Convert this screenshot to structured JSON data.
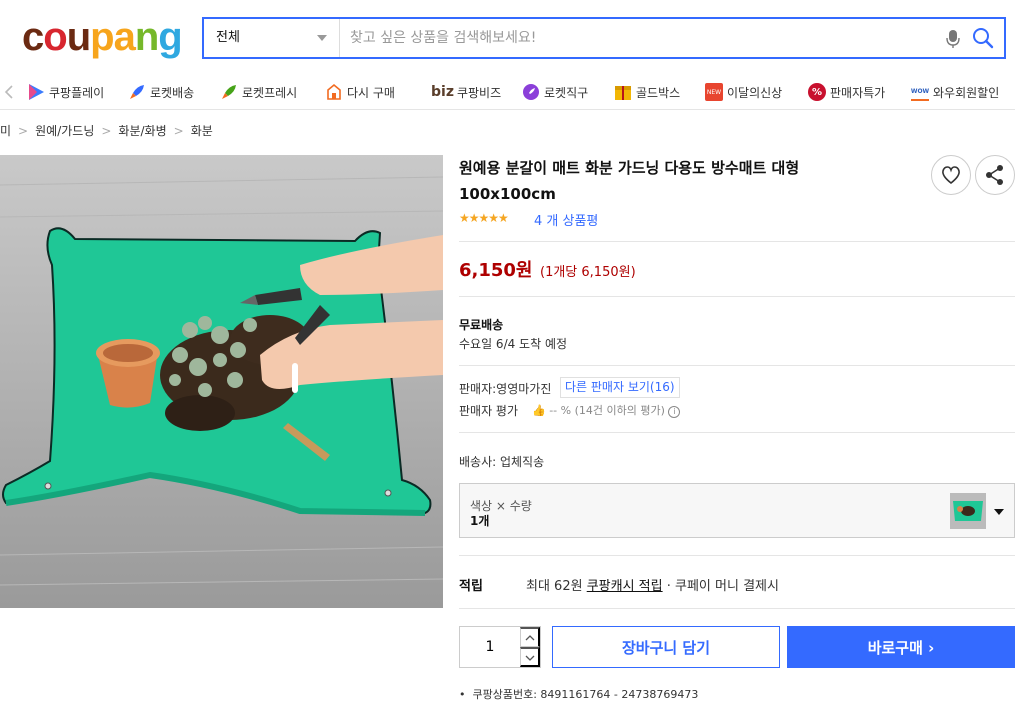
{
  "header": {
    "logo_letters": [
      {
        "ch": "c",
        "color": "#6b2a12"
      },
      {
        "ch": "o",
        "color": "#d8262f"
      },
      {
        "ch": "u",
        "color": "#6b2a12"
      },
      {
        "ch": "p",
        "color": "#f7a51c"
      },
      {
        "ch": "a",
        "color": "#f7a51c"
      },
      {
        "ch": "n",
        "color": "#76b82a"
      },
      {
        "ch": "g",
        "color": "#2fa8e0"
      }
    ],
    "logo_text": "coupang",
    "search_category": "전체",
    "search_placeholder": "찾고 싶은 상품을 검색해보세요!"
  },
  "nav": [
    {
      "label": "쿠팡플레이",
      "icon": "coupang-play-icon"
    },
    {
      "label": "로켓배송",
      "icon": "rocket-delivery-icon"
    },
    {
      "label": "로켓프레시",
      "icon": "rocket-fresh-icon"
    },
    {
      "label": "다시 구매",
      "icon": "rebuy-icon"
    },
    {
      "label": "쿠팡비즈",
      "prefix": "biz",
      "icon": "biz-icon"
    },
    {
      "label": "로켓직구",
      "icon": "rocket-global-icon"
    },
    {
      "label": "골드박스",
      "icon": "goldbox-icon"
    },
    {
      "label": "이달의신상",
      "icon": "new-icon",
      "icon_text": "NEW"
    },
    {
      "label": "판매자특가",
      "icon": "seller-deal-icon",
      "icon_text": "%"
    },
    {
      "label": "와우회원할인",
      "icon": "wow-icon",
      "icon_text": "WOW"
    }
  ],
  "breadcrumb": [
    "미",
    "원예/가드닝",
    "화분/화병",
    "화분"
  ],
  "product": {
    "title": "원예용 분갈이 매트 화분 가드닝 다용도 방수매트 대형 100x100cm",
    "stars": "★★★★★",
    "rating": 5,
    "review_count": "4 개 상품평",
    "price": "6,150원",
    "unit_price": "(1개당 6,150원)",
    "shipping_label": "무료배송",
    "shipping_eta": "수요일 6/4 도착 예정",
    "seller_label": "판매자:영영마가진",
    "other_sellers": "다른 판매자 보기(16)",
    "seller_rating_label": "판매자 평가",
    "seller_rating_value": "-- % (14건 이하의 평가)",
    "carrier": "배송사:  업체직송",
    "option_label": "색상 × 수량",
    "option_value": "1개",
    "reward_label": "적립",
    "reward_prefix": "최대 62원",
    "reward_link": "쿠팡캐시 적립",
    "reward_suffix": "· 쿠페이 머니 결제시",
    "quantity": "1",
    "cart_button": "장바구니 담기",
    "buy_button": "바로구매 ",
    "product_number": "쿠팡상품번호: 8491161764 - 24738769473"
  },
  "colors": {
    "accent": "#346aff",
    "price": "#ae0000",
    "mat": "#1fc796",
    "floor": "#a9a9a9"
  }
}
